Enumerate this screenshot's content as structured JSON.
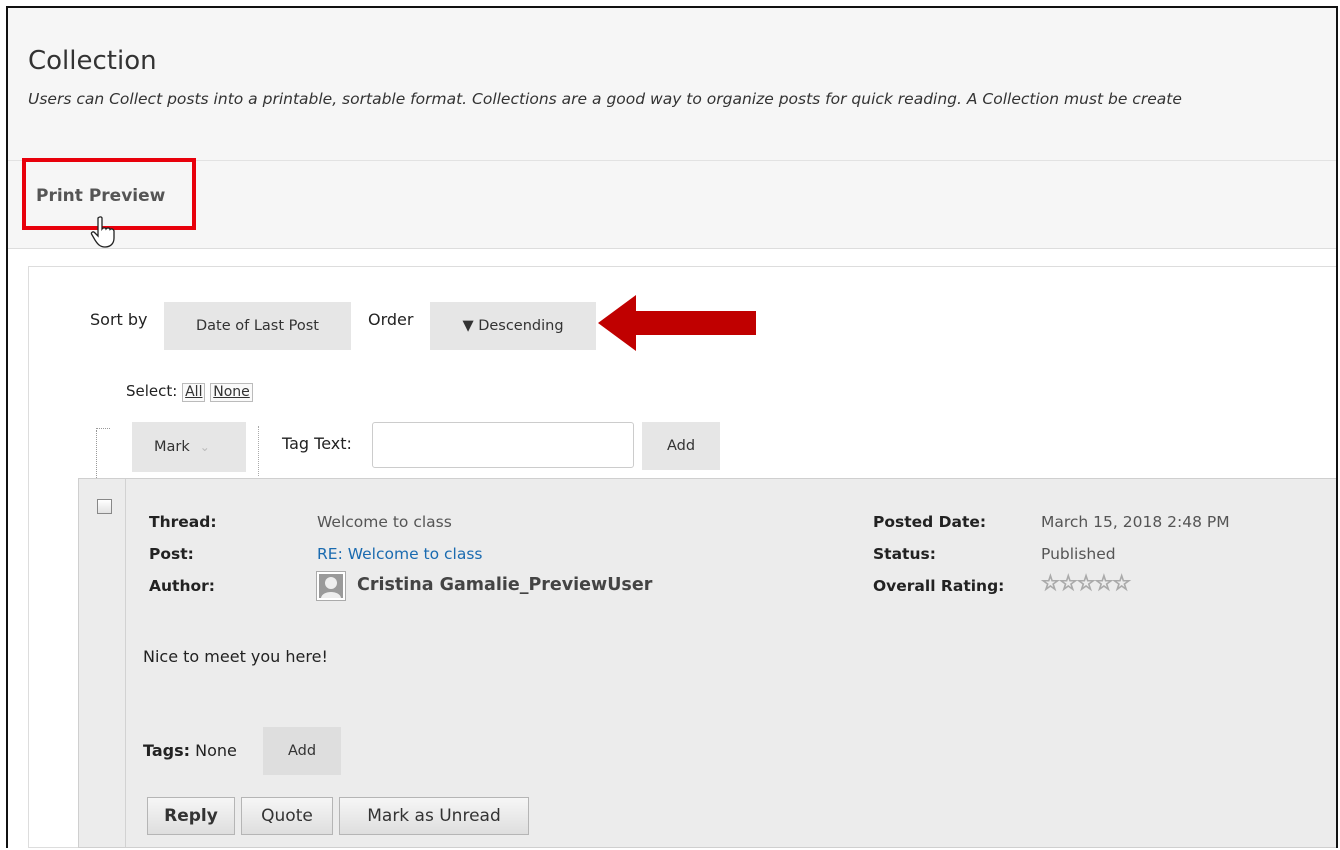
{
  "header": {
    "title": "Collection",
    "description": "Users can Collect posts into a printable, sortable format. Collections are a good way to organize posts for quick reading. A Collection must be create"
  },
  "toolbar": {
    "print_preview_label": "Print Preview"
  },
  "sort": {
    "sort_by_label": "Sort by",
    "sort_by_value": "Date of Last Post",
    "order_label": "Order",
    "order_value": "▼ Descending"
  },
  "select": {
    "label": "Select:",
    "all": "All",
    "none": "None"
  },
  "actions": {
    "mark_label": "Mark",
    "tag_text_label": "Tag Text:",
    "tag_input_value": "",
    "add_label": "Add"
  },
  "post": {
    "thread_label": "Thread:",
    "thread_value": "Welcome to class",
    "post_label": "Post:",
    "post_value": "RE: Welcome to class",
    "author_label": "Author:",
    "author_value": "Cristina Gamalie_PreviewUser",
    "posted_date_label": "Posted Date:",
    "posted_date_value": "March 15, 2018 2:48 PM",
    "status_label": "Status:",
    "status_value": "Published",
    "rating_label": "Overall Rating:",
    "rating_stars": "☆☆☆☆☆",
    "body": "Nice to meet you here!",
    "tags_label": "Tags:",
    "tags_value": "None",
    "tags_add": "Add",
    "reply": "Reply",
    "quote": "Quote",
    "mark_unread": "Mark as Unread"
  },
  "colors": {
    "highlight": "#e8000b",
    "arrow": "#c00000",
    "link": "#1a6bb0"
  }
}
